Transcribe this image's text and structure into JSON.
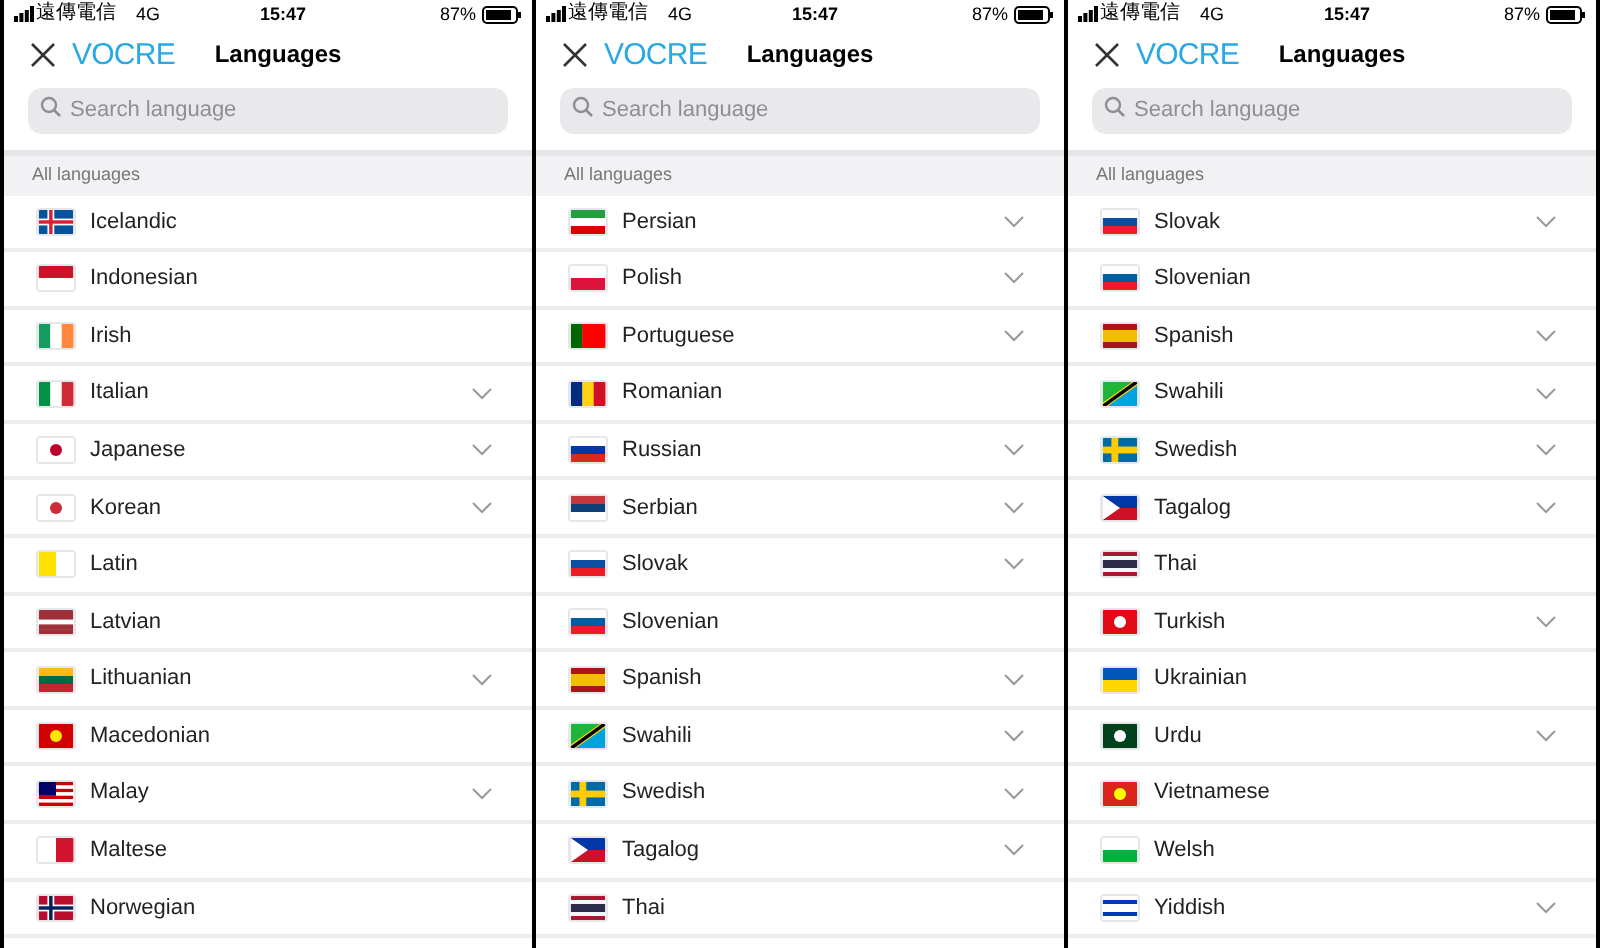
{
  "panels": [
    {
      "status_bar": {
        "carrier": "遠傳電信",
        "network": "4G",
        "time": "15:47",
        "battery": "87%"
      },
      "header": {
        "logo": "VOCRE",
        "title": "Languages"
      },
      "search": {
        "placeholder": "Search language"
      },
      "section_label": "All languages",
      "languages": [
        {
          "name": "Icelandic",
          "expandable": false
        },
        {
          "name": "Indonesian",
          "expandable": false
        },
        {
          "name": "Irish",
          "expandable": false
        },
        {
          "name": "Italian",
          "expandable": true
        },
        {
          "name": "Japanese",
          "expandable": true
        },
        {
          "name": "Korean",
          "expandable": true
        },
        {
          "name": "Latin",
          "expandable": false
        },
        {
          "name": "Latvian",
          "expandable": false
        },
        {
          "name": "Lithuanian",
          "expandable": true
        },
        {
          "name": "Macedonian",
          "expandable": false
        },
        {
          "name": "Malay",
          "expandable": true
        },
        {
          "name": "Maltese",
          "expandable": false
        },
        {
          "name": "Norwegian",
          "expandable": false
        }
      ]
    },
    {
      "status_bar": {
        "carrier": "遠傳電信",
        "network": "4G",
        "time": "15:47",
        "battery": "87%"
      },
      "header": {
        "logo": "VOCRE",
        "title": "Languages"
      },
      "search": {
        "placeholder": "Search language"
      },
      "section_label": "All languages",
      "languages": [
        {
          "name": "Persian",
          "expandable": true
        },
        {
          "name": "Polish",
          "expandable": true
        },
        {
          "name": "Portuguese",
          "expandable": true
        },
        {
          "name": "Romanian",
          "expandable": false
        },
        {
          "name": "Russian",
          "expandable": true
        },
        {
          "name": "Serbian",
          "expandable": true
        },
        {
          "name": "Slovak",
          "expandable": true
        },
        {
          "name": "Slovenian",
          "expandable": false
        },
        {
          "name": "Spanish",
          "expandable": true
        },
        {
          "name": "Swahili",
          "expandable": true
        },
        {
          "name": "Swedish",
          "expandable": true
        },
        {
          "name": "Tagalog",
          "expandable": true
        },
        {
          "name": "Thai",
          "expandable": false
        }
      ]
    },
    {
      "status_bar": {
        "carrier": "遠傳電信",
        "network": "4G",
        "time": "15:47",
        "battery": "87%"
      },
      "header": {
        "logo": "VOCRE",
        "title": "Languages"
      },
      "search": {
        "placeholder": "Search language"
      },
      "section_label": "All languages",
      "languages": [
        {
          "name": "Slovak",
          "expandable": true
        },
        {
          "name": "Slovenian",
          "expandable": false
        },
        {
          "name": "Spanish",
          "expandable": true
        },
        {
          "name": "Swahili",
          "expandable": true
        },
        {
          "name": "Swedish",
          "expandable": true
        },
        {
          "name": "Tagalog",
          "expandable": true
        },
        {
          "name": "Thai",
          "expandable": false
        },
        {
          "name": "Turkish",
          "expandable": true
        },
        {
          "name": "Ukrainian",
          "expandable": false
        },
        {
          "name": "Urdu",
          "expandable": true
        },
        {
          "name": "Vietnamese",
          "expandable": false
        },
        {
          "name": "Welsh",
          "expandable": false
        },
        {
          "name": "Yiddish",
          "expandable": true
        }
      ]
    }
  ]
}
